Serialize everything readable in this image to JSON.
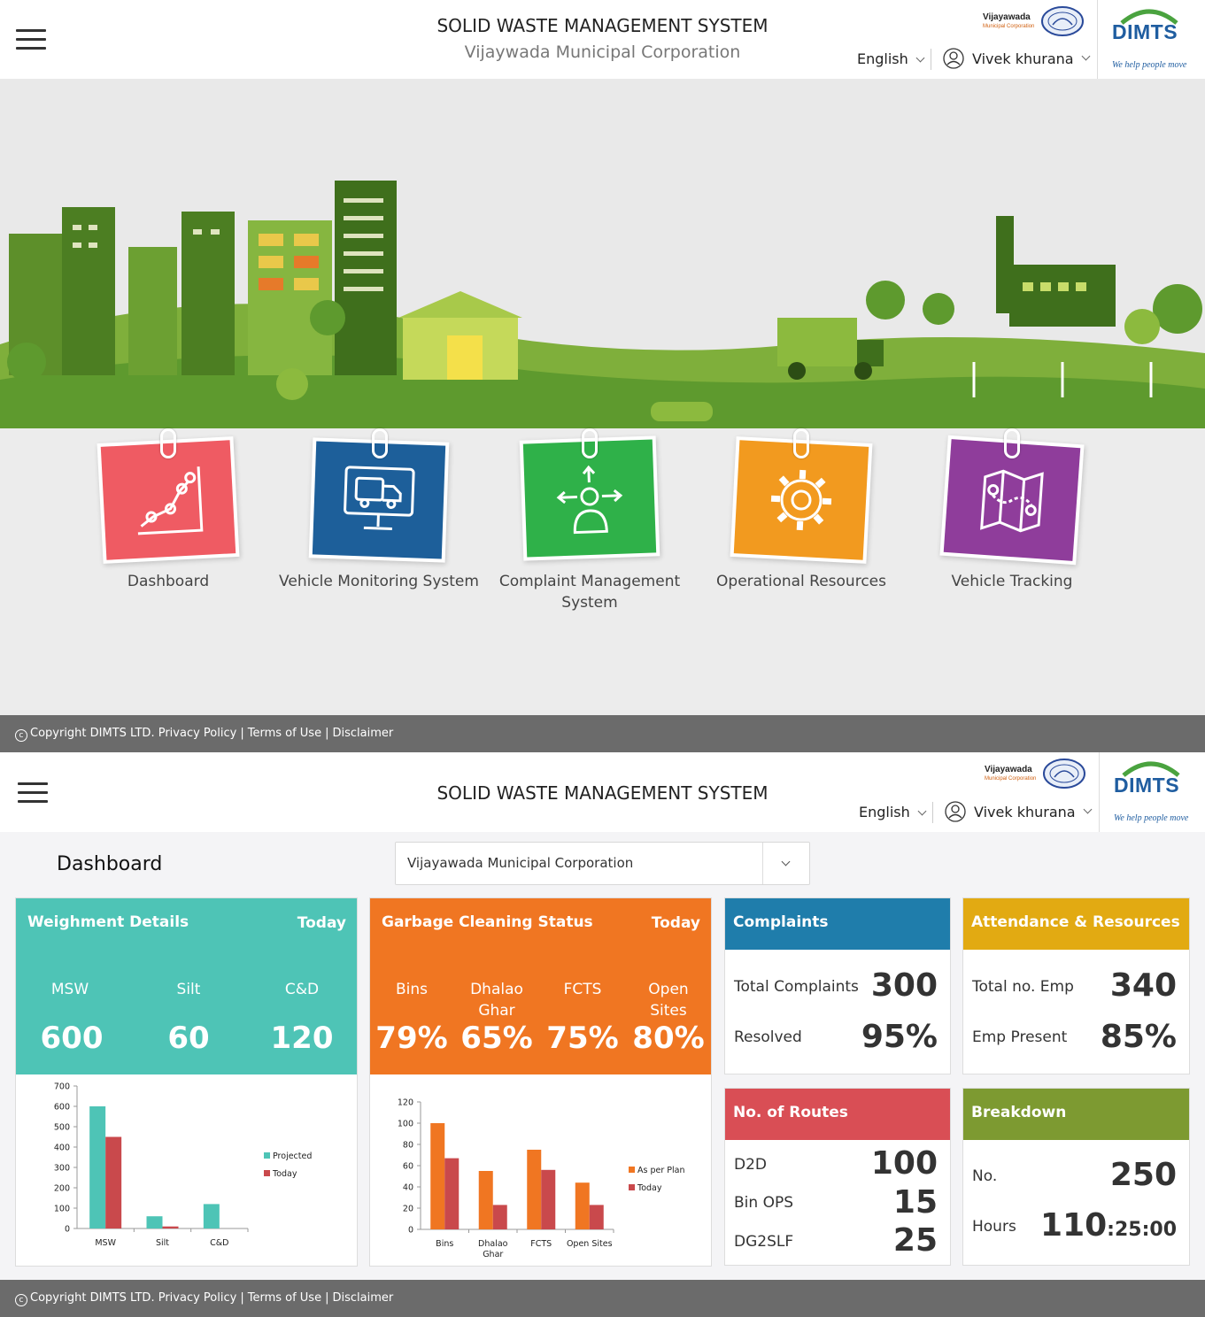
{
  "header": {
    "title": "SOLID WASTE MANAGEMENT SYSTEM",
    "subtitle": "Vijaywada Municipal Corporation",
    "language": "English",
    "user": "Vivek khurana",
    "vmc_logo_name": "Vijayawada",
    "vmc_logo_sub": "Municipal Corporation",
    "dimts_logo": "DIMTS",
    "dimts_tagline": "We help people move"
  },
  "tiles": [
    {
      "label": "Dashboard",
      "color": "#ef5b63",
      "icon": "line-chart-icon"
    },
    {
      "label": "Vehicle Monitoring System",
      "color": "#1d5f9a",
      "icon": "truck-monitor-icon"
    },
    {
      "label": "Complaint Management System",
      "color": "#2fb149",
      "icon": "person-arrows-icon"
    },
    {
      "label": "Operational Resources",
      "color": "#f29a1f",
      "icon": "gear-icon"
    },
    {
      "label": "Vehicle Tracking",
      "color": "#8f3d9b",
      "icon": "map-route-icon"
    }
  ],
  "footer": {
    "copyright": "Copyright DIMTS LTD.",
    "privacy": "Privacy Policy",
    "terms": "Terms of Use",
    "disclaimer": "Disclaimer"
  },
  "dashboard": {
    "title": "Dashboard",
    "corporation": "Vijayawada Municipal Corporation",
    "weighment": {
      "title": "Weighment Details",
      "period": "Today",
      "metrics": [
        {
          "label": "MSW",
          "value": "600"
        },
        {
          "label": "Silt",
          "value": "60"
        },
        {
          "label": "C&D",
          "value": "120"
        }
      ],
      "color": "#4ec4b6"
    },
    "garbage": {
      "title": "Garbage Cleaning Status",
      "period": "Today",
      "metrics": [
        {
          "label": "Bins",
          "value": "79%"
        },
        {
          "label": "Dhalao Ghar",
          "value": "65%"
        },
        {
          "label": "FCTS",
          "value": "75%"
        },
        {
          "label": "Open Sites",
          "value": "80%"
        }
      ],
      "color": "#f07622"
    },
    "complaints": {
      "title": "Complaints",
      "color": "#1f7dab",
      "rows": [
        {
          "label": "Total Complaints",
          "value": "300"
        },
        {
          "label": "Resolved",
          "value": "95%"
        }
      ]
    },
    "attendance": {
      "title": "Attendance & Resources",
      "color": "#e2aa12",
      "rows": [
        {
          "label": "Total no. Emp",
          "value": "340"
        },
        {
          "label": "Emp Present",
          "value": "85%"
        }
      ]
    },
    "routes": {
      "title": "No. of Routes",
      "color": "#d94e55",
      "rows": [
        {
          "label": "D2D",
          "value": "100"
        },
        {
          "label": "Bin OPS",
          "value": "15"
        },
        {
          "label": "DG2SLF",
          "value": "25"
        }
      ]
    },
    "breakdown": {
      "title": "Breakdown",
      "color": "#7d9a31",
      "rows": [
        {
          "label": "No.",
          "value": "250"
        },
        {
          "label": "Hours",
          "value_main": "110",
          "value_suffix": ":25:00"
        }
      ]
    }
  },
  "chart_data": [
    {
      "type": "bar",
      "categories": [
        "MSW",
        "Silt",
        "C&D"
      ],
      "series": [
        {
          "name": "Projected",
          "values": [
            600,
            60,
            120
          ],
          "color": "#4ec4b6"
        },
        {
          "name": "Today",
          "values": [
            450,
            10,
            0
          ],
          "color": "#c9494c"
        }
      ],
      "ylim": [
        0,
        700
      ],
      "yticks": [
        0,
        100,
        200,
        300,
        400,
        500,
        600,
        700
      ],
      "legend": "right"
    },
    {
      "type": "bar",
      "categories": [
        "Bins",
        "Dhalao Ghar",
        "FCTS",
        "Open Sites"
      ],
      "series": [
        {
          "name": "As per Plan",
          "values": [
            100,
            55,
            75,
            44
          ],
          "color": "#f07622"
        },
        {
          "name": "Today",
          "values": [
            67,
            23,
            56,
            23
          ],
          "color": "#c9494c"
        }
      ],
      "ylim": [
        0,
        120
      ],
      "yticks": [
        0,
        20,
        40,
        60,
        80,
        100,
        120
      ],
      "legend": "right"
    }
  ]
}
